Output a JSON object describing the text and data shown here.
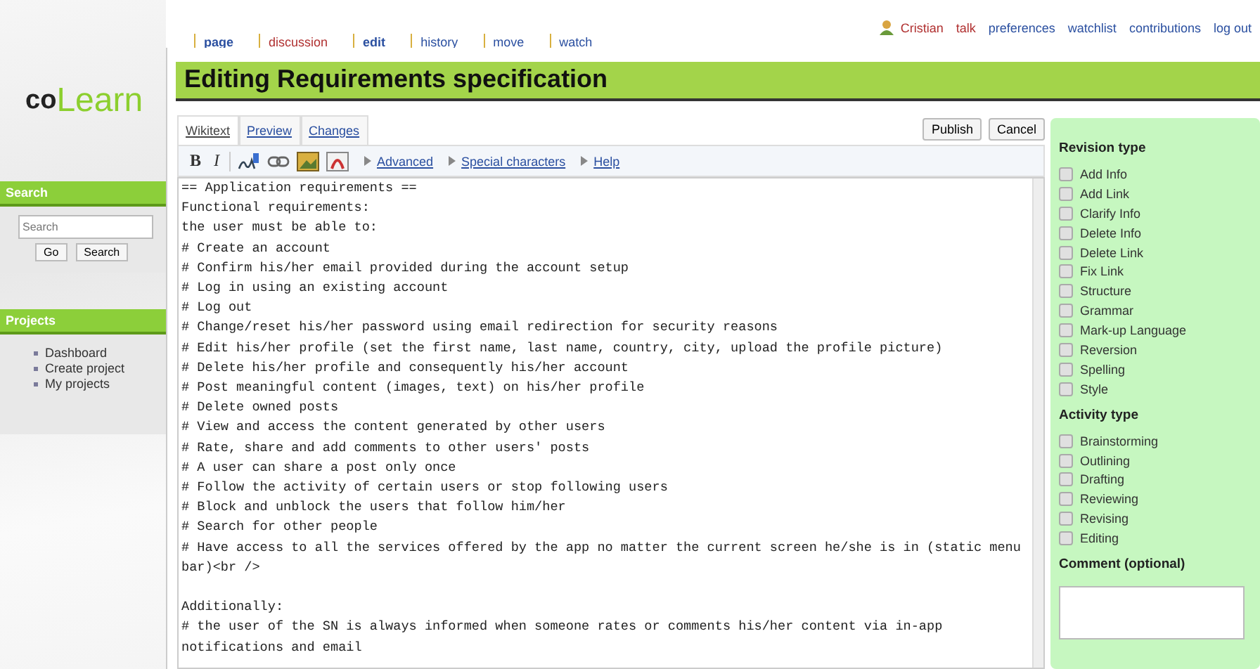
{
  "user_links": [
    {
      "label": "Cristian",
      "missing": true,
      "kind": "user"
    },
    {
      "label": "talk",
      "missing": true,
      "kind": "link"
    },
    {
      "label": "preferences",
      "missing": false,
      "kind": "link"
    },
    {
      "label": "watchlist",
      "missing": false,
      "kind": "link"
    },
    {
      "label": "contributions",
      "missing": false,
      "kind": "link"
    },
    {
      "label": "log out",
      "missing": false,
      "kind": "link"
    }
  ],
  "page_tabs": [
    {
      "label": "page",
      "selected": true,
      "missing": false
    },
    {
      "label": "discussion",
      "selected": false,
      "missing": true
    },
    {
      "label": "edit",
      "selected": true,
      "missing": false
    },
    {
      "label": "history",
      "selected": false,
      "missing": false
    },
    {
      "label": "move",
      "selected": false,
      "missing": false
    },
    {
      "label": "watch",
      "selected": false,
      "missing": false
    }
  ],
  "logo": {
    "first": "co",
    "second": "Learn"
  },
  "title": "Editing Requirements specification",
  "sidebar": {
    "search": {
      "heading": "Search",
      "placeholder": "Search",
      "buttons": [
        "Go",
        "Search"
      ]
    },
    "projects": {
      "heading": "Projects",
      "items": [
        "Dashboard",
        "Create project",
        "My projects"
      ]
    }
  },
  "editor": {
    "tabs": [
      {
        "label": "Wikitext",
        "selected": true
      },
      {
        "label": "Preview",
        "selected": false
      },
      {
        "label": "Changes",
        "selected": false
      }
    ],
    "buttons": [
      "Publish",
      "Cancel"
    ],
    "format": [
      "B",
      "I"
    ],
    "menus": [
      "Advanced",
      "Special characters",
      "Help"
    ],
    "blocks": [
      [
        "== Application requirements ==",
        "Functional requirements:",
        "the user must be able to:",
        "# Create an account",
        "# Confirm his/her email provided during the account setup",
        "# Log in using an existing account",
        "# Log out",
        "# Change/reset his/her password using email redirection for security reasons",
        "# Edit his/her profile (set the first name, last name, country, city, upload the profile picture)",
        "# Delete his/her profile and consequently his/her account",
        "# Post meaningful content (images, text) on his/her profile",
        "# Delete owned posts",
        "# View and access the content generated by other users",
        "# Rate, share and add comments to other users' posts",
        "# A user can share a post only once",
        "# Follow the activity of certain users or stop following users",
        "# Block and unblock the users that follow him/her",
        "# Search for other people",
        "# Have access to all the services offered by the app no matter the current screen he/she is in (static menu bar)<br />"
      ],
      [
        "Additionally:",
        "# the user of the SN is always informed when someone rates or comments his/her content via in-app notifications and email"
      ]
    ]
  },
  "panel": {
    "sections": [
      {
        "heading": "Revision type",
        "options": [
          {
            "label": "Add Info",
            "checked": false
          },
          {
            "label": "Add Link",
            "checked": false
          },
          {
            "label": "Clarify Info",
            "checked": false
          },
          {
            "label": "Delete Info",
            "checked": false
          },
          {
            "label": "Delete Link",
            "checked": false
          },
          {
            "label": "Fix Link",
            "checked": false
          },
          {
            "label": "Structure",
            "checked": false
          },
          {
            "label": "Grammar",
            "checked": false
          },
          {
            "label": "Mark-up Language",
            "checked": false
          },
          {
            "label": "Reversion",
            "checked": false
          },
          {
            "label": "Spelling",
            "checked": false
          },
          {
            "label": "Style",
            "checked": false
          }
        ]
      },
      {
        "heading": "Activity type",
        "options": [
          {
            "label": "Brainstorming",
            "checked": false
          },
          {
            "label": "Outlining",
            "checked": false
          },
          {
            "label": "Drafting",
            "checked": false
          },
          {
            "label": "Reviewing",
            "checked": false
          },
          {
            "label": "Revising",
            "checked": false
          },
          {
            "label": "Editing",
            "checked": false
          }
        ]
      }
    ],
    "comment_heading": "Comment (optional)"
  }
}
